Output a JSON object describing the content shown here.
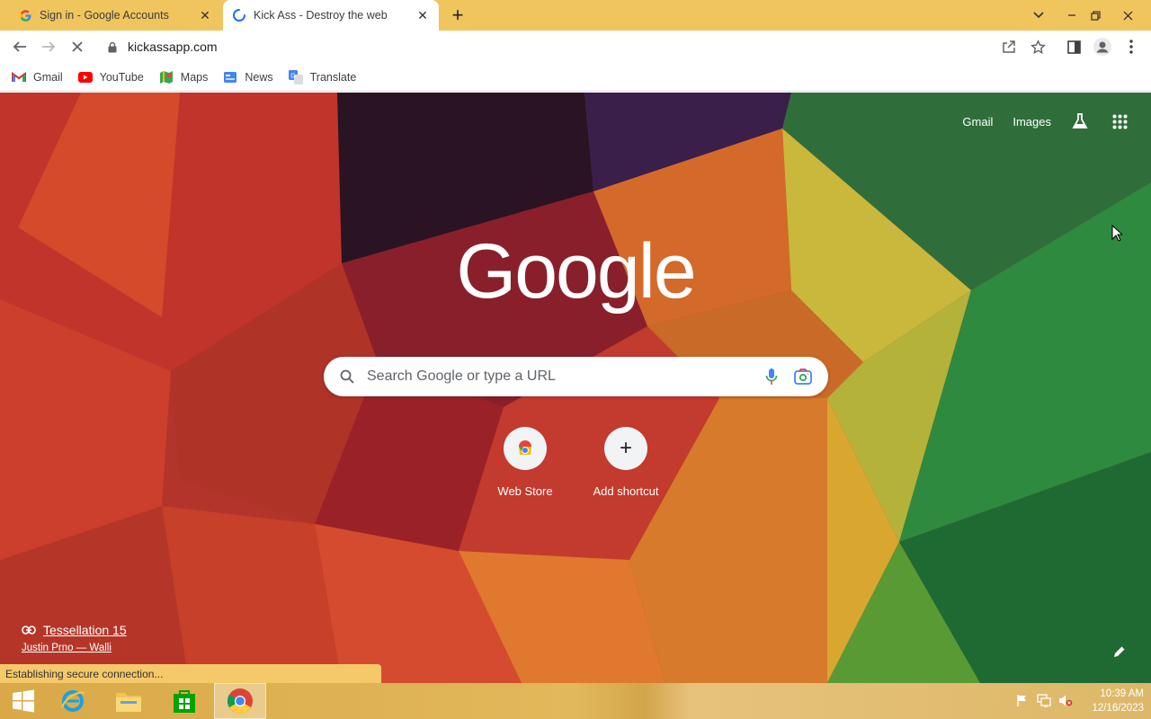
{
  "tabs": [
    {
      "title": "Sign in - Google Accounts",
      "close": "✕",
      "favicon": "google-g-icon"
    },
    {
      "title": "Kick Ass - Destroy the web",
      "close": "✕",
      "favicon": "loading-spinner-icon"
    }
  ],
  "newtab_label": "+",
  "address": {
    "url": "kickassapp.com"
  },
  "bookmarks": [
    {
      "label": "Gmail",
      "icon": "gmail-icon"
    },
    {
      "label": "YouTube",
      "icon": "youtube-icon"
    },
    {
      "label": "Maps",
      "icon": "maps-icon"
    },
    {
      "label": "News",
      "icon": "news-icon"
    },
    {
      "label": "Translate",
      "icon": "translate-icon"
    }
  ],
  "ntp": {
    "top_links": {
      "gmail": "Gmail",
      "images": "Images"
    },
    "logo": "Google",
    "search_placeholder": "Search Google or type a URL",
    "shortcuts": [
      {
        "label": "Web Store"
      },
      {
        "label": "Add shortcut",
        "icon_text": "+"
      }
    ],
    "attribution": {
      "title": "Tessellation 15",
      "author": "Justin Prno — Walli"
    }
  },
  "status_text": "Establishing secure connection...",
  "taskbar": {
    "time": "10:39 AM",
    "date": "12/16/2023"
  },
  "colors": {
    "tabstrip": "#f0c55e",
    "status_bg": "#f5c86a"
  }
}
